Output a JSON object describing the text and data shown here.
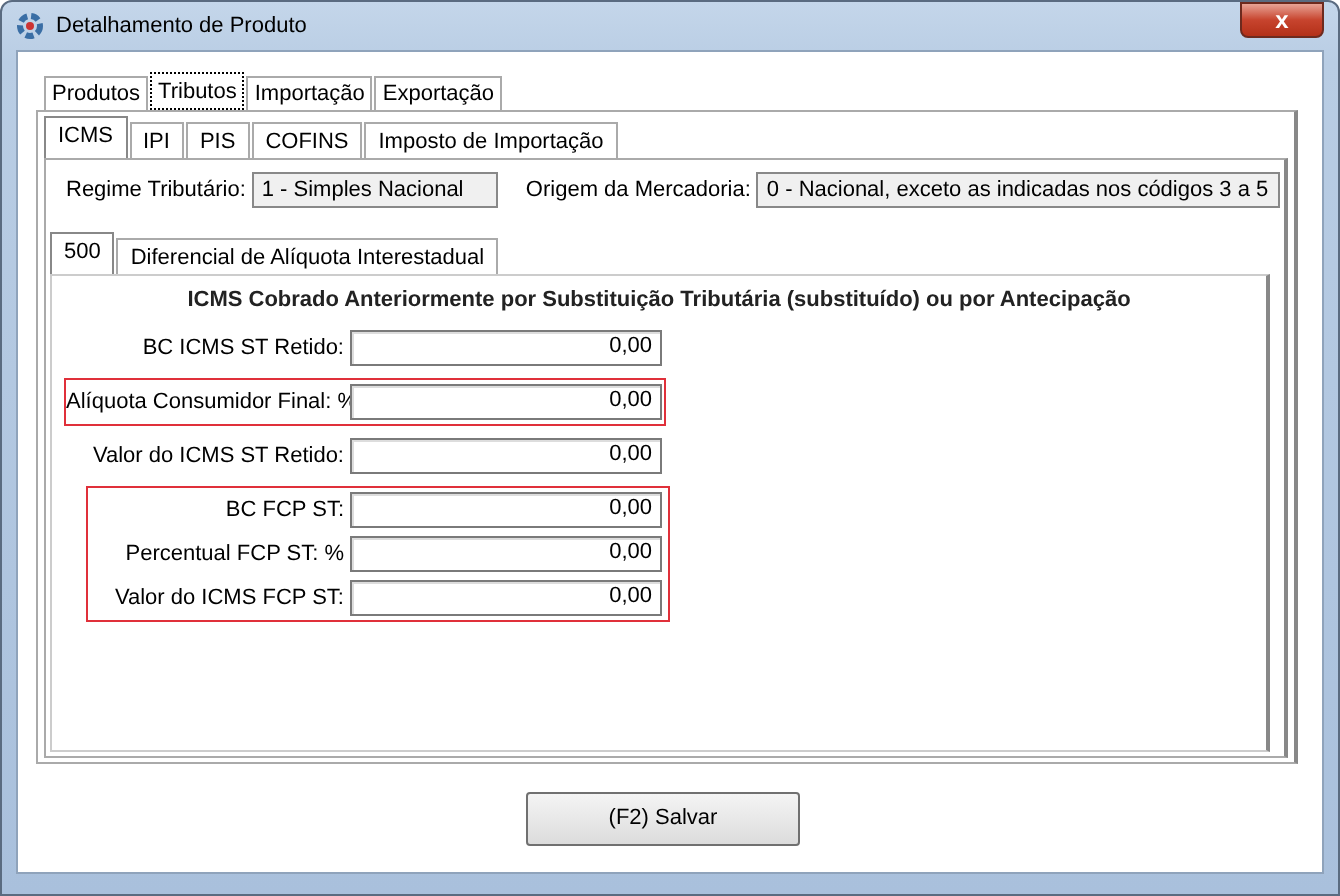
{
  "window": {
    "title": "Detalhamento de Produto",
    "close": "x"
  },
  "tabs": [
    {
      "label": "Produtos",
      "selected": false
    },
    {
      "label": "Tributos",
      "selected": true
    },
    {
      "label": "Importação",
      "selected": false
    },
    {
      "label": "Exportação",
      "selected": false
    }
  ],
  "subtabs": [
    {
      "label": "ICMS",
      "selected": true
    },
    {
      "label": "IPI",
      "selected": false
    },
    {
      "label": "PIS",
      "selected": false
    },
    {
      "label": "COFINS",
      "selected": false
    },
    {
      "label": "Imposto de Importação",
      "selected": false
    }
  ],
  "regime": {
    "label": "Regime Tributário:",
    "value": "1 - Simples Nacional"
  },
  "origem": {
    "label": "Origem da Mercadoria:",
    "value": "0 - Nacional, exceto as indicadas nos códigos 3 a 5"
  },
  "inner_tabs": [
    {
      "label": "500",
      "selected": true
    },
    {
      "label": "Diferencial de Alíquota Interestadual",
      "selected": false
    }
  ],
  "heading": "ICMS Cobrado Anteriormente por Substituição Tributária (substituído) ou por Antecipação",
  "groups": [
    {
      "highlighted": false,
      "fields": [
        {
          "label": "BC ICMS ST Retido:",
          "value": "0,00"
        }
      ]
    },
    {
      "highlighted": true,
      "fields": [
        {
          "label": "Alíquota Consumidor Final: %",
          "value": "0,00"
        }
      ]
    },
    {
      "highlighted": false,
      "fields": [
        {
          "label": "Valor do ICMS ST Retido:",
          "value": "0,00"
        }
      ]
    },
    {
      "highlighted": true,
      "fields": [
        {
          "label": "BC FCP ST:",
          "value": "0,00"
        },
        {
          "label": "Percentual FCP ST: %",
          "value": "0,00"
        },
        {
          "label": "Valor do ICMS FCP ST:",
          "value": "0,00"
        }
      ]
    }
  ],
  "save_button": "(F2) Salvar"
}
